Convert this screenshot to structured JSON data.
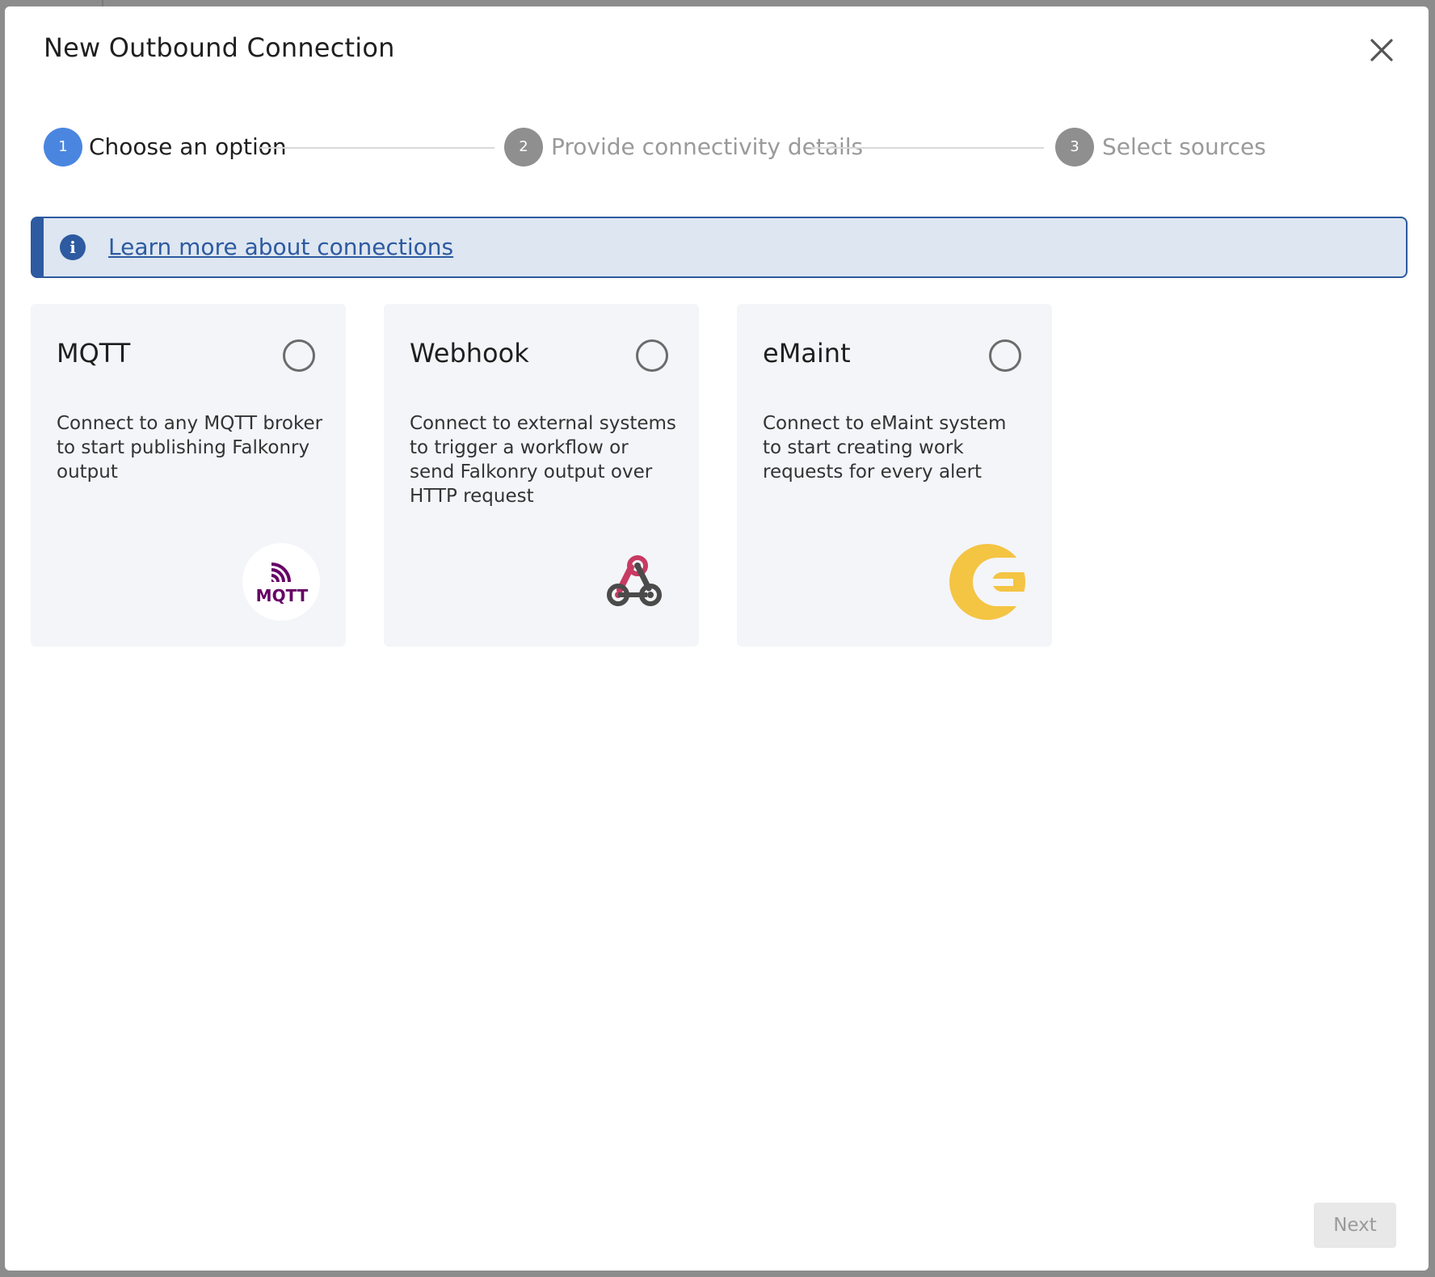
{
  "dialog": {
    "title": "New Outbound Connection"
  },
  "stepper": {
    "steps": [
      {
        "number": "1",
        "label": "Choose an option",
        "state": "active",
        "color": "#4a86e0"
      },
      {
        "number": "2",
        "label": "Provide connectivity details",
        "state": "inactive",
        "color": "#8f8f8f"
      },
      {
        "number": "3",
        "label": "Select sources",
        "state": "inactive",
        "color": "#8f8f8f"
      }
    ]
  },
  "info_banner": {
    "icon": "info-icon",
    "link_text": "Learn more about connections",
    "accent_color": "#2d5aa0"
  },
  "options": [
    {
      "title": "MQTT",
      "description": "Connect to any MQTT broker to start publishing Falkonry output",
      "logo": "mqtt-logo",
      "logo_text": "MQTT",
      "selected": false
    },
    {
      "title": "Webhook",
      "description": "Connect to external systems to trigger a workflow or send Falkonry output over HTTP request",
      "logo": "webhook-logo",
      "selected": false
    },
    {
      "title": "eMaint",
      "description": "Connect to eMaint system to start creating work requests for every alert",
      "logo": "emaint-logo",
      "selected": false
    }
  ],
  "footer": {
    "next_label": "Next",
    "next_enabled": false
  }
}
